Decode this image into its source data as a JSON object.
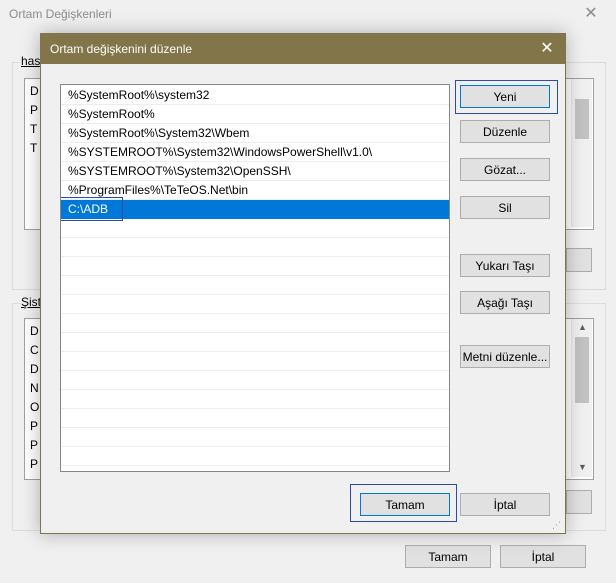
{
  "parent_window": {
    "title": "Ortam Değişkenleri",
    "user_group_label": "hası",
    "user_vars_rows": [
      "D",
      "P",
      "T",
      "T"
    ],
    "system_group_label": "Şist",
    "system_vars_rows": [
      "D",
      "C",
      "D",
      "N",
      "O",
      "P",
      "P",
      "P"
    ],
    "ok_label": "Tamam",
    "cancel_label": "İptal"
  },
  "dialog": {
    "title": "Ortam değişkenini düzenle",
    "close_glyph": "✕",
    "paths": [
      "%SystemRoot%\\system32",
      "%SystemRoot%",
      "%SystemRoot%\\System32\\Wbem",
      "%SYSTEMROOT%\\System32\\WindowsPowerShell\\v1.0\\",
      "%SYSTEMROOT%\\System32\\OpenSSH\\",
      "%ProgramFiles%\\TeTeOS.Net\\bin",
      "C:\\ADB"
    ],
    "selected_index": 6,
    "buttons": {
      "new": "Yeni",
      "edit": "Düzenle",
      "browse": "Gözat...",
      "delete": "Sil",
      "move_up": "Yukarı Taşı",
      "move_down": "Aşağı Taşı",
      "edit_text": "Metni düzenle...",
      "ok": "Tamam",
      "cancel": "İptal"
    }
  },
  "colors": {
    "titlebar": "#817549",
    "selection": "#0078d7",
    "focus_border": "#2d4aa8"
  }
}
